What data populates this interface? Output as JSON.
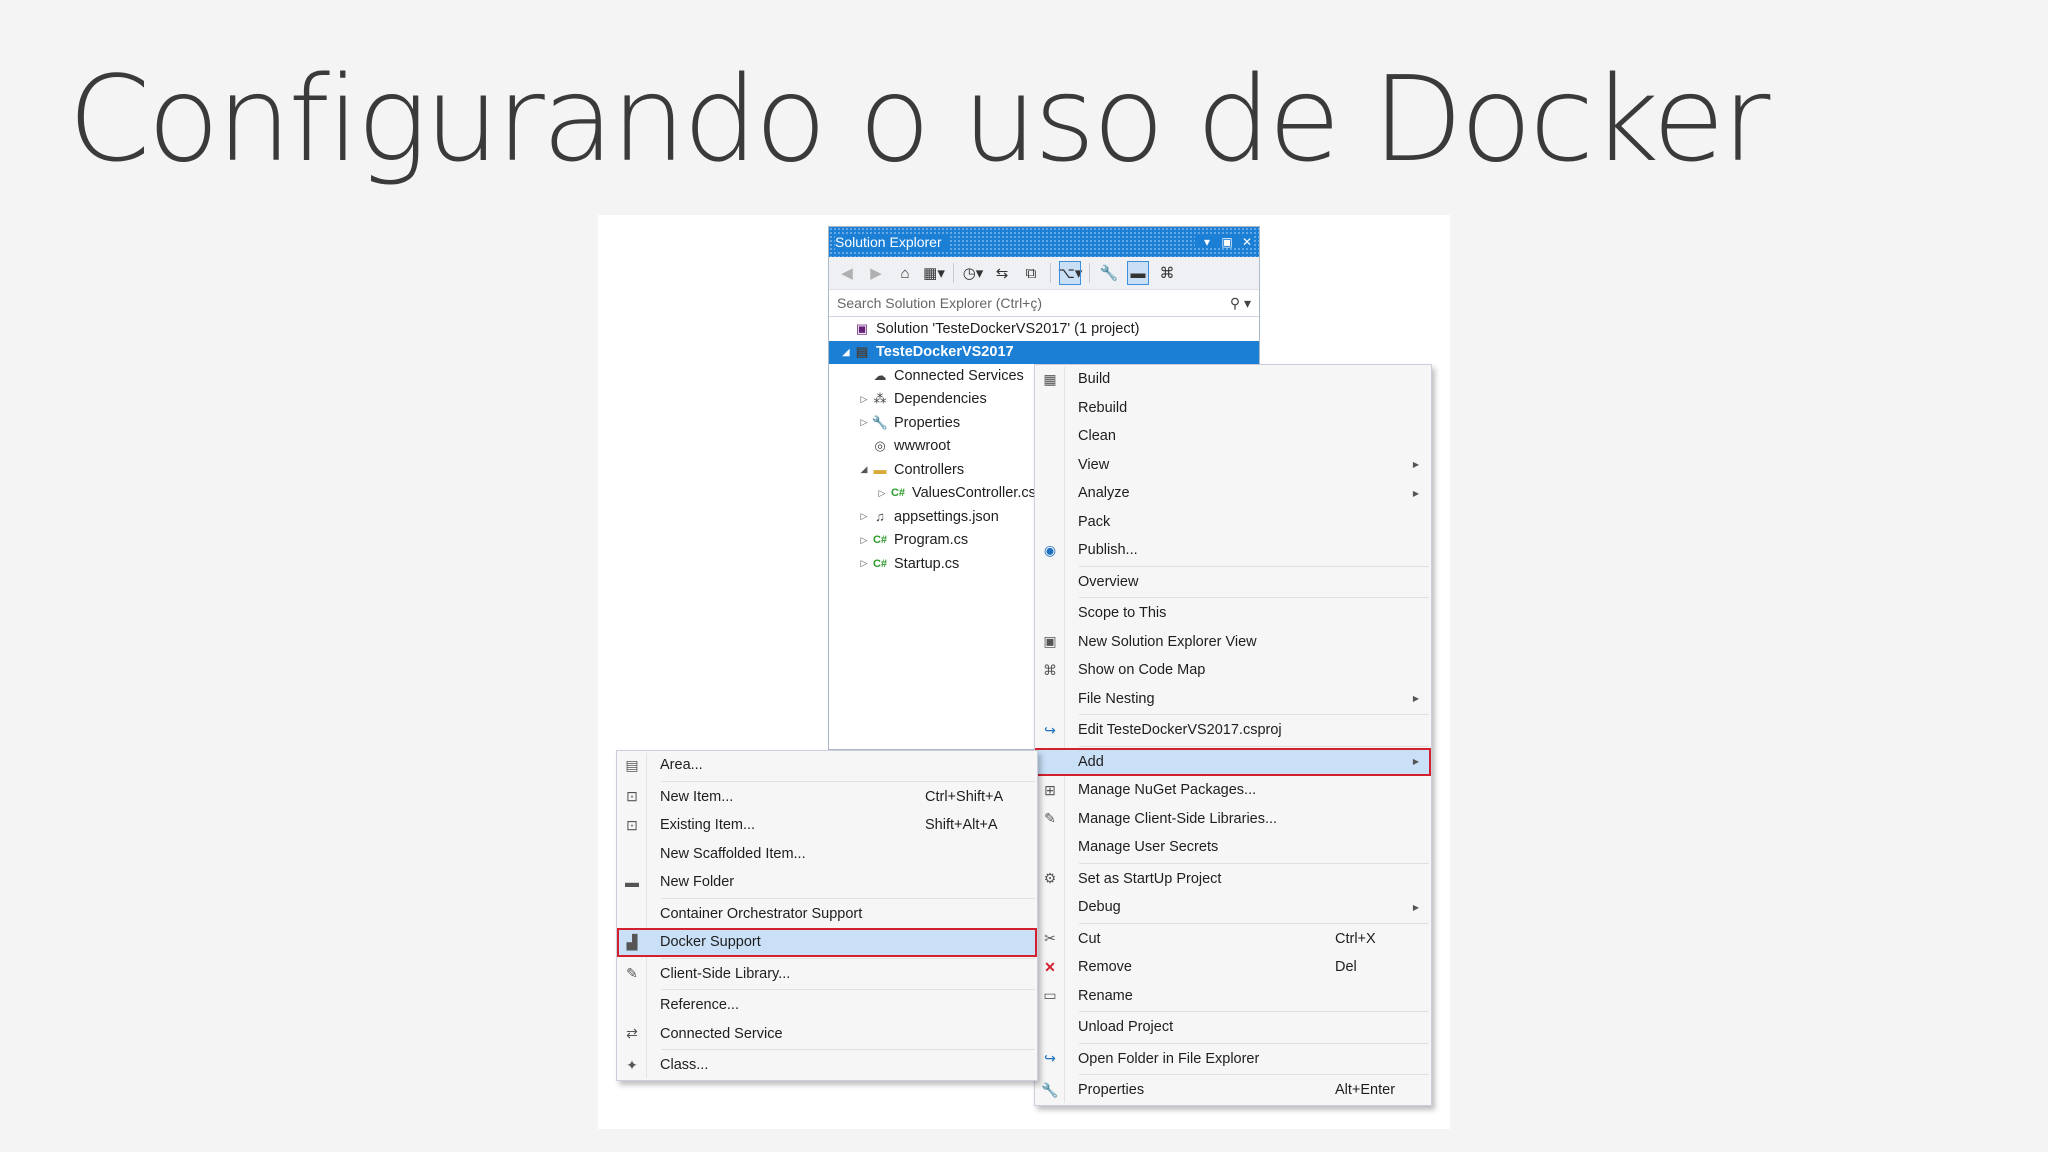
{
  "slide": {
    "title": "Configurando o uso de Docker"
  },
  "solution_explorer": {
    "title": "Solution Explorer",
    "search_placeholder": "Search Solution Explorer (Ctrl+ç)",
    "tree": [
      {
        "label": "Solution 'TesteDockerVS2017' (1 project)",
        "indent": 0,
        "arrow": "",
        "icon": "solution-icon",
        "glyph": "▣"
      },
      {
        "label": "TesteDockerVS2017",
        "indent": 0,
        "arrow": "◢",
        "icon": "project-icon",
        "glyph": "▤",
        "selected": true
      },
      {
        "label": "Connected Services",
        "indent": 1,
        "arrow": "",
        "icon": "connected-services-icon",
        "glyph": "☁"
      },
      {
        "label": "Dependencies",
        "indent": 1,
        "arrow": "▷",
        "icon": "dependencies-icon",
        "glyph": "⁂"
      },
      {
        "label": "Properties",
        "indent": 1,
        "arrow": "▷",
        "icon": "wrench-icon",
        "glyph": "🔧"
      },
      {
        "label": "wwwroot",
        "indent": 1,
        "arrow": "",
        "icon": "globe-icon",
        "glyph": "◎"
      },
      {
        "label": "Controllers",
        "indent": 1,
        "arrow": "◢",
        "icon": "folder-icon",
        "glyph": "▬"
      },
      {
        "label": "ValuesController.cs",
        "indent": 2,
        "arrow": "▷",
        "icon": "csharp-icon",
        "glyph": "C#"
      },
      {
        "label": "appsettings.json",
        "indent": 1,
        "arrow": "▷",
        "icon": "json-icon",
        "glyph": "♫"
      },
      {
        "label": "Program.cs",
        "indent": 1,
        "arrow": "▷",
        "icon": "csharp-icon",
        "glyph": "C#"
      },
      {
        "label": "Startup.cs",
        "indent": 1,
        "arrow": "▷",
        "icon": "csharp-icon",
        "glyph": "C#"
      }
    ]
  },
  "context_menu": [
    {
      "label": "Build",
      "icon": "build-icon",
      "glyph": "▦"
    },
    {
      "label": "Rebuild"
    },
    {
      "label": "Clean"
    },
    {
      "label": "View",
      "submenu": true
    },
    {
      "label": "Analyze",
      "submenu": true
    },
    {
      "label": "Pack"
    },
    {
      "label": "Publish...",
      "icon": "publish-icon",
      "glyph": "◉",
      "blue": true
    },
    {
      "sep": true
    },
    {
      "label": "Overview"
    },
    {
      "sep": true
    },
    {
      "label": "Scope to This"
    },
    {
      "label": "New Solution Explorer View",
      "icon": "new-view-icon",
      "glyph": "▣"
    },
    {
      "label": "Show on Code Map",
      "icon": "code-map-icon",
      "glyph": "⌘"
    },
    {
      "label": "File Nesting",
      "submenu": true
    },
    {
      "sep": true
    },
    {
      "label": "Edit TesteDockerVS2017.csproj",
      "icon": "edit-project-icon",
      "glyph": "↪",
      "blue": true
    },
    {
      "sep": true
    },
    {
      "label": "Add",
      "submenu": true,
      "highlight": true
    },
    {
      "label": "Manage NuGet Packages...",
      "icon": "nuget-icon",
      "glyph": "⊞"
    },
    {
      "label": "Manage Client-Side Libraries...",
      "icon": "client-lib-icon",
      "glyph": "✎"
    },
    {
      "label": "Manage User Secrets"
    },
    {
      "sep": true
    },
    {
      "label": "Set as StartUp Project",
      "icon": "gear-icon",
      "glyph": "⚙"
    },
    {
      "label": "Debug",
      "submenu": true
    },
    {
      "sep": true
    },
    {
      "label": "Cut",
      "shortcut": "Ctrl+X",
      "icon": "cut-icon",
      "glyph": "✂"
    },
    {
      "label": "Remove",
      "shortcut": "Del",
      "icon": "remove-icon",
      "glyph": "✕",
      "red": true
    },
    {
      "label": "Rename",
      "icon": "rename-icon",
      "glyph": "▭"
    },
    {
      "sep": true
    },
    {
      "label": "Unload Project"
    },
    {
      "sep": true
    },
    {
      "label": "Open Folder in File Explorer",
      "icon": "open-folder-icon",
      "glyph": "↪",
      "blue": true
    },
    {
      "sep": true
    },
    {
      "label": "Properties",
      "shortcut": "Alt+Enter",
      "icon": "wrench-icon",
      "glyph": "🔧"
    }
  ],
  "add_submenu": [
    {
      "label": "Area...",
      "icon": "area-icon",
      "glyph": "▤"
    },
    {
      "sep": true
    },
    {
      "label": "New Item...",
      "shortcut": "Ctrl+Shift+A",
      "icon": "new-item-icon",
      "glyph": "⊡"
    },
    {
      "label": "Existing Item...",
      "shortcut": "Shift+Alt+A",
      "icon": "existing-item-icon",
      "glyph": "⊡"
    },
    {
      "label": "New Scaffolded Item..."
    },
    {
      "label": "New Folder",
      "icon": "new-folder-icon",
      "glyph": "▬"
    },
    {
      "sep": true
    },
    {
      "label": "Container Orchestrator Support"
    },
    {
      "label": "Docker Support",
      "icon": "docker-icon",
      "glyph": "▟",
      "highlight": true
    },
    {
      "sep": true
    },
    {
      "label": "Client-Side Library...",
      "icon": "client-lib-icon",
      "glyph": "✎"
    },
    {
      "sep": true
    },
    {
      "label": "Reference..."
    },
    {
      "label": "Connected Service",
      "icon": "connected-service-icon",
      "glyph": "⇄"
    },
    {
      "sep": true
    },
    {
      "label": "Class...",
      "icon": "class-icon",
      "glyph": "✦"
    }
  ]
}
